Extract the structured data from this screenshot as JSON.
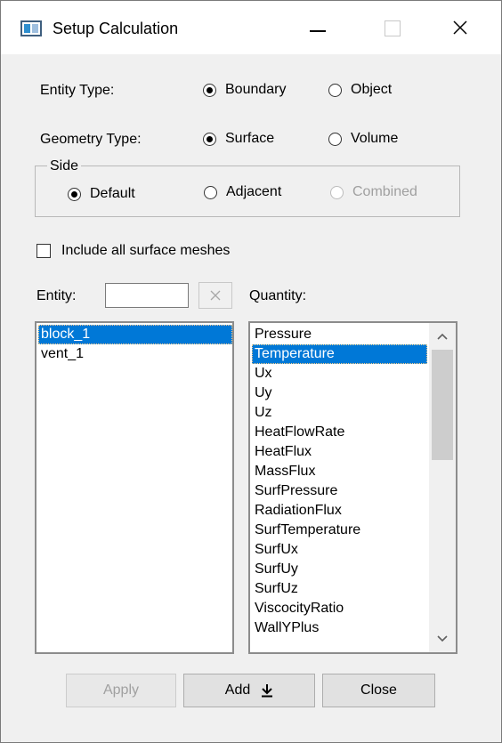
{
  "window": {
    "title": "Setup Calculation"
  },
  "entity_type": {
    "label": "Entity Type:",
    "options": [
      "Boundary",
      "Object"
    ],
    "selected": "Boundary"
  },
  "geometry_type": {
    "label": "Geometry Type:",
    "options": [
      "Surface",
      "Volume"
    ],
    "selected": "Surface"
  },
  "side": {
    "label": "Side",
    "options": [
      "Default",
      "Adjacent",
      "Combined"
    ],
    "selected": "Default",
    "disabled": [
      "Combined"
    ]
  },
  "include_meshes": {
    "label": "Include all surface meshes",
    "checked": false
  },
  "entity": {
    "label": "Entity:",
    "value": "",
    "items": [
      "block_1",
      "vent_1"
    ],
    "selected": "block_1"
  },
  "quantity": {
    "label": "Quantity:",
    "items": [
      "Pressure",
      "Temperature",
      "Ux",
      "Uy",
      "Uz",
      "HeatFlowRate",
      "HeatFlux",
      "MassFlux",
      "SurfPressure",
      "RadiationFlux",
      "SurfTemperature",
      "SurfUx",
      "SurfUy",
      "SurfUz",
      "ViscocityRatio",
      "WallYPlus"
    ],
    "selected": "Temperature"
  },
  "buttons": {
    "apply": "Apply",
    "add": "Add",
    "close": "Close"
  },
  "colors": {
    "selection": "#0078d7",
    "window_bg": "#f0f0f0"
  },
  "icons": {
    "clear": "close-icon",
    "add": "download-arrow-icon"
  }
}
